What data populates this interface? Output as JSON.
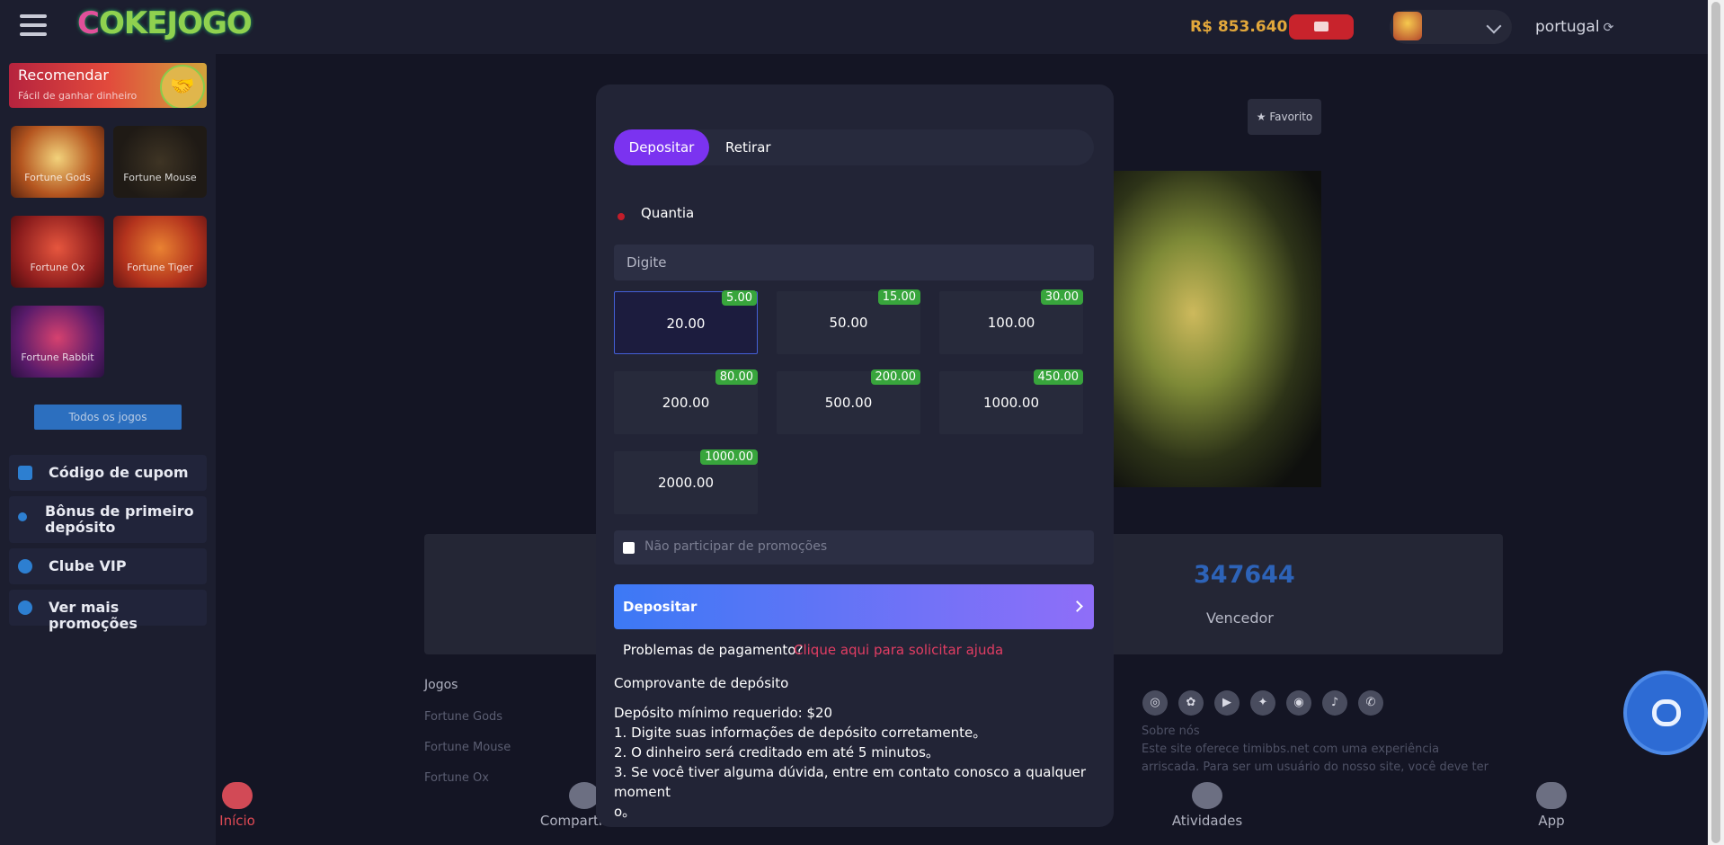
{
  "header": {
    "logo_text_c": "C",
    "logo_text_rest": "OKEJOGO",
    "balance": "R$ 853.640",
    "language": "portugal"
  },
  "sidebar": {
    "promo_title": "Recomendar",
    "promo_subtitle": "Fácil de ganhar dinheiro",
    "games": [
      {
        "label": "Fortune Gods"
      },
      {
        "label": "Fortune Mouse"
      },
      {
        "label": "Fortune Ox"
      },
      {
        "label": "Fortune Tiger"
      },
      {
        "label": "Fortune Rabbit"
      }
    ],
    "all_games": "Todos os jogos",
    "menu": [
      {
        "label": "Código de cupom"
      },
      {
        "label": "Bônus de primeiro depósito"
      },
      {
        "label": "Clube VIP"
      },
      {
        "label": "Ver mais promoções"
      }
    ]
  },
  "background": {
    "favorite": "★ Favorito",
    "stat_number": "347644",
    "stat_label": "Vencedor",
    "footer_heading": "Jogos",
    "footer_links": [
      "Fortune Gods",
      "Fortune Mouse",
      "Fortune Ox"
    ],
    "about_title": "Sobre nós",
    "about_line1": "Este site oferece timibbs.net com uma experiência",
    "about_line2": "arriscada. Para ser um usuário do nosso site, você deve ter",
    "bottom_nav": [
      {
        "label": "Início"
      },
      {
        "label": "Compartilhar"
      },
      {
        "label": "Atividades"
      },
      {
        "label": "App"
      }
    ]
  },
  "modal": {
    "tab_deposit": "Depositar",
    "tab_withdraw": "Retirar",
    "amount_label": "Quantia",
    "amount_placeholder": "Digite",
    "options": [
      {
        "value": "20.00",
        "bonus": "5.00"
      },
      {
        "value": "50.00",
        "bonus": "15.00"
      },
      {
        "value": "100.00",
        "bonus": "30.00"
      },
      {
        "value": "200.00",
        "bonus": "80.00"
      },
      {
        "value": "500.00",
        "bonus": "200.00"
      },
      {
        "value": "1000.00",
        "bonus": "450.00"
      },
      {
        "value": "2000.00",
        "bonus": "1000.00"
      }
    ],
    "no_promo_label": "Não participar de promoções",
    "deposit_button": "Depositar",
    "help_question": "Problemas de pagamento?",
    "help_link": "Clique aqui para solicitar ajuda",
    "receipt": "Comprovante de depósito",
    "notes": [
      "Depósito mínimo requerido: $20",
      "1. Digite suas informações de depósito corretamente。",
      "2. O dinheiro será creditado em até 5 minutos。",
      "3. Se você tiver alguma dúvida, entre em contato conosco a qualquer moment",
      "o。"
    ]
  },
  "colors": {
    "accent_purple": "#7b33f0",
    "bonus_green": "#38a53c",
    "link_red": "#e23d63",
    "balance_gold": "#e3a83b"
  }
}
